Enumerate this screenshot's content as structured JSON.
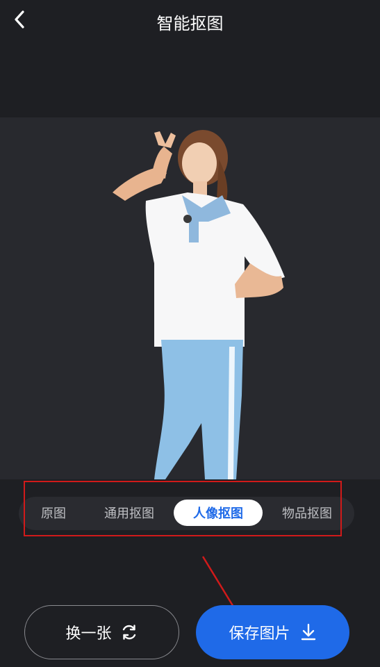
{
  "header": {
    "title": "智能抠图",
    "back_icon": "chevron-left-icon"
  },
  "preview": {
    "background_color": "#28292e"
  },
  "tabs": [
    {
      "label": "原图",
      "active": false
    },
    {
      "label": "通用抠图",
      "active": false
    },
    {
      "label": "人像抠图",
      "active": true
    },
    {
      "label": "物品抠图",
      "active": false
    }
  ],
  "actions": {
    "swap_label": "换一张",
    "swap_icon": "refresh-icon",
    "save_label": "保存图片",
    "save_icon": "download-icon"
  },
  "colors": {
    "accent": "#1f6ae8",
    "annotation": "#d11a1a",
    "background": "#1e1f23"
  }
}
